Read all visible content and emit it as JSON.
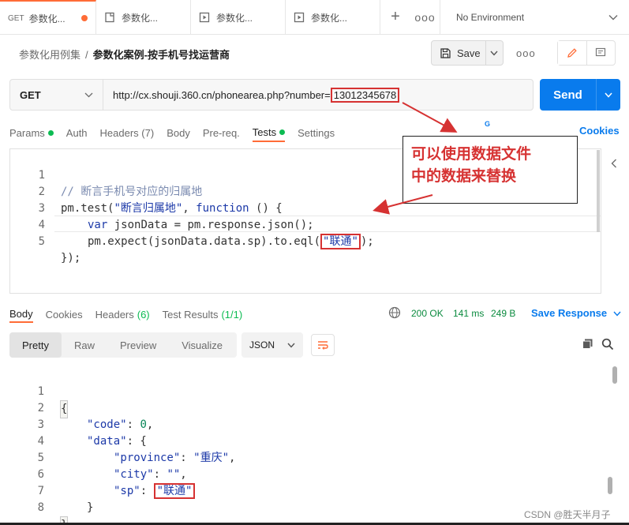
{
  "tabs": [
    {
      "method": "GET",
      "title": "参数化...",
      "icon": "get-request-icon",
      "unsaved": true
    },
    {
      "title": "参数化...",
      "icon": "document-icon"
    },
    {
      "title": "参数化...",
      "icon": "runner-icon"
    },
    {
      "title": "参数化...",
      "icon": "runner-icon"
    }
  ],
  "tabbar": {
    "plus": "+",
    "more": "ooo",
    "environment": "No Environment"
  },
  "breadcrumb": {
    "parent": "参数化用例集",
    "separator": "/",
    "current": "参数化案例-按手机号找运营商"
  },
  "toolbar": {
    "save_label": "Save",
    "more": "ooo"
  },
  "request": {
    "method": "GET",
    "url_prefix": "http://cx.shouji.360.cn/phonearea.php?number=",
    "url_number": "13012345678",
    "send_label": "Send"
  },
  "request_tabs": [
    {
      "label": "Params",
      "dot": true
    },
    {
      "label": "Auth"
    },
    {
      "label": "Headers (7)"
    },
    {
      "label": "Body"
    },
    {
      "label": "Pre-req."
    },
    {
      "label": "Tests",
      "dot": true,
      "active": true
    },
    {
      "label": "Settings"
    }
  ],
  "cookies_label": "Cookies",
  "g_label": "G",
  "editor": {
    "lines": [
      "1",
      "2",
      "3",
      "4",
      "5"
    ],
    "l1": "// 断言手机号对应的归属地",
    "l2_a": "pm.test(",
    "l2_b": "\"断言归属地\"",
    "l2_c": ", ",
    "l2_d": "function",
    "l2_e": " () {",
    "l3_a": "var",
    "l3_b": " jsonData = pm.response.json();",
    "l4_a": "pm.expect(jsonData.data.sp).to.eql(",
    "l4_b": "\"联通\"",
    "l4_c": ");",
    "l5": "});"
  },
  "annotation": {
    "line1": "可以使用数据文件",
    "line2": "中的数据来替换"
  },
  "response_tabs": [
    {
      "label": "Body",
      "active": true
    },
    {
      "label": "Cookies"
    },
    {
      "label": "Headers",
      "count": "(6)"
    },
    {
      "label": "Test Results",
      "count": "(1/1)"
    }
  ],
  "response_meta": {
    "status": "200 OK",
    "time": "141 ms",
    "size": "249 B",
    "save": "Save Response"
  },
  "format_tabs": [
    {
      "label": "Pretty",
      "active": true
    },
    {
      "label": "Raw"
    },
    {
      "label": "Preview"
    },
    {
      "label": "Visualize"
    }
  ],
  "format_select": "JSON",
  "response_body": {
    "lines": [
      "1",
      "2",
      "3",
      "4",
      "5",
      "6",
      "7",
      "8"
    ],
    "open": "{",
    "code_key": "\"code\"",
    "code_val": "0",
    "data_key": "\"data\"",
    "province_key": "\"province\"",
    "province_val": "\"重庆\"",
    "city_key": "\"city\"",
    "city_val": "\"\"",
    "sp_key": "\"sp\"",
    "sp_val": "\"联通\"",
    "inner_close": "}",
    "close": "}"
  },
  "watermark": "CSDN @胜天半月子",
  "colors": {
    "accent": "#ff6c37",
    "send": "#097bed",
    "status_ok": "#0a8a3e",
    "highlight": "#d63232",
    "dot": "#0cbb52"
  }
}
